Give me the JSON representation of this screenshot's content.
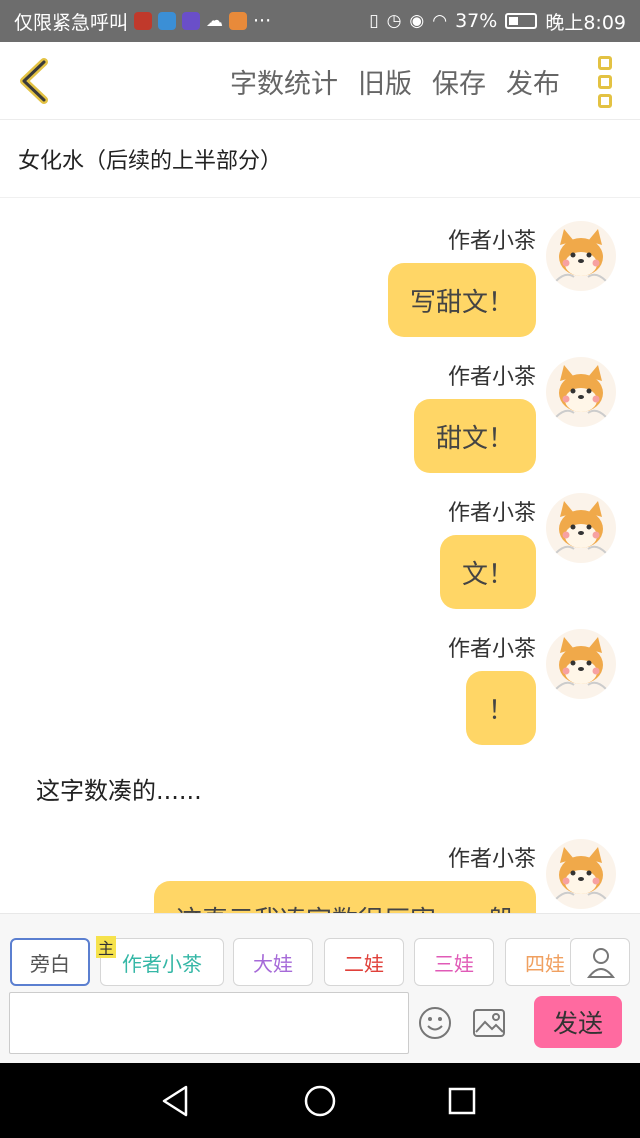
{
  "status_bar": {
    "carrier": "仅限紧急呼叫",
    "more_dots": "···",
    "battery_percent": "37%",
    "time": "晚上8:09"
  },
  "top_bar": {
    "word_count": "字数统计",
    "old_version": "旧版",
    "save": "保存",
    "publish": "发布"
  },
  "title": "女化水（后续的上半部分）",
  "messages": [
    {
      "author": "作者小茶",
      "text": "写甜文！"
    },
    {
      "author": "作者小茶",
      "text": "甜文！"
    },
    {
      "author": "作者小茶",
      "text": "文！"
    },
    {
      "author": "作者小茶",
      "text": "！"
    },
    {
      "author": "作者小茶",
      "text": "这真元我凑字数很厉害……般"
    }
  ],
  "narration": "这字数凑的......",
  "roles": [
    {
      "label": "旁白",
      "color": "#555555"
    },
    {
      "label": "作者小茶",
      "color": "#35b7a6"
    },
    {
      "label": "大娃",
      "color": "#a66ad8"
    },
    {
      "label": "二娃",
      "color": "#e0403a"
    },
    {
      "label": "三娃",
      "color": "#e05ab7"
    },
    {
      "label": "四娃",
      "color": "#f0a060"
    }
  ],
  "main_tag": "主",
  "input": {
    "value": "",
    "placeholder": ""
  },
  "send_label": "发送",
  "colors": {
    "accent": "#ffd666",
    "send": "#ff6aa0",
    "icon_yellow": "#e3c243"
  },
  "icons": [
    "back-chevron-icon",
    "more-vertical-icon",
    "user-icon",
    "emoji-icon",
    "image-icon",
    "nav-back-icon",
    "nav-home-icon",
    "nav-recents-icon"
  ]
}
